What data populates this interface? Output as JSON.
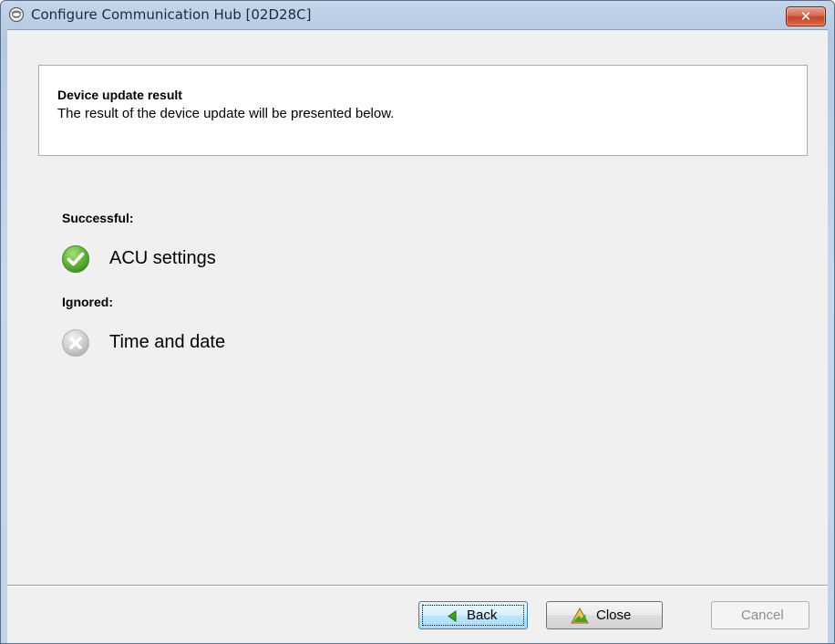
{
  "window": {
    "title": "Configure Communication Hub [02D28C]",
    "close_glyph": "✕"
  },
  "header": {
    "title": "Device update result",
    "subtitle": "The result of the device update will be presented below."
  },
  "results": {
    "successful_label": "Successful:",
    "successful_items": [
      "ACU settings"
    ],
    "ignored_label": "Ignored:",
    "ignored_items": [
      "Time and date"
    ]
  },
  "buttons": {
    "back": "Back",
    "close": "Close",
    "cancel": "Cancel"
  },
  "icons": {
    "success": "check-circle-icon",
    "ignored": "x-circle-icon",
    "back": "back-arrow-icon",
    "close": "warning-triangle-icon",
    "app": "hub-icon"
  },
  "colors": {
    "success_green": "#5fb336",
    "ignored_gray": "#c9c9c9",
    "titlebar_blue": "#b9cde6",
    "close_red": "#c3452b"
  }
}
